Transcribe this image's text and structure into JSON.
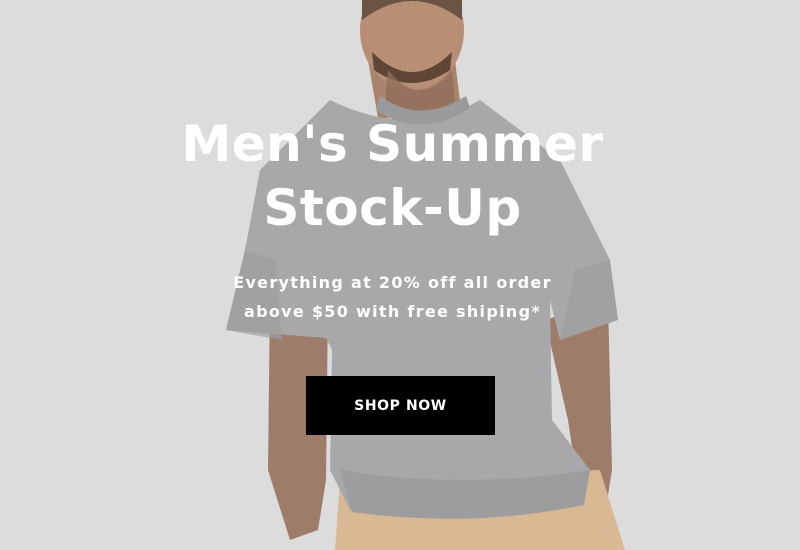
{
  "hero": {
    "headline_line1": "Men's Summer",
    "headline_line2": "Stock-Up",
    "subtext_line1": "Everything at 20% off all order",
    "subtext_line2": "above $50 with free shiping*",
    "cta_label": "SHOP NOW"
  },
  "colors": {
    "background": "#dcdcdd",
    "shirt": "#a8a8aa",
    "skin": "#b08a70",
    "pants": "#d9b993",
    "text": "#ffffff",
    "button": "#000000"
  }
}
